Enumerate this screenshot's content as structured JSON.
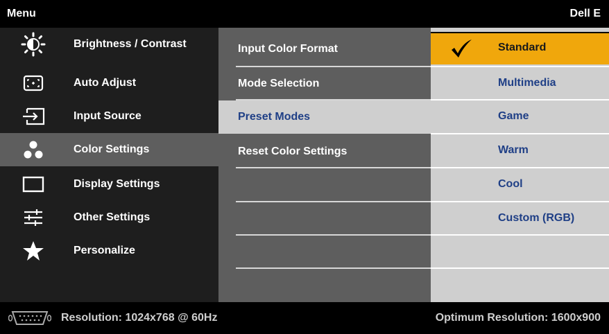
{
  "header": {
    "title": "Menu",
    "brand": "Dell E"
  },
  "nav": {
    "items": [
      {
        "label": "Brightness / Contrast",
        "icon": "brightness-icon"
      },
      {
        "label": "Auto Adjust",
        "icon": "auto-adjust-icon"
      },
      {
        "label": "Input Source",
        "icon": "input-source-icon"
      },
      {
        "label": "Color Settings",
        "icon": "color-settings-icon",
        "active": true
      },
      {
        "label": "Display Settings",
        "icon": "display-settings-icon"
      },
      {
        "label": "Other Settings",
        "icon": "other-settings-icon"
      },
      {
        "label": "Personalize",
        "icon": "star-icon"
      }
    ]
  },
  "color_settings": {
    "items": [
      {
        "label": "Input Color Format"
      },
      {
        "label": "Mode Selection"
      },
      {
        "label": "Preset Modes",
        "highlighted": true
      },
      {
        "label": "Reset Color Settings"
      }
    ]
  },
  "preset_modes": {
    "selected": "Standard",
    "options": [
      {
        "label": "Standard"
      },
      {
        "label": "Multimedia"
      },
      {
        "label": "Game"
      },
      {
        "label": "Warm"
      },
      {
        "label": "Cool"
      },
      {
        "label": "Custom (RGB)"
      }
    ]
  },
  "status": {
    "resolution": "Resolution: 1024x768 @ 60Hz",
    "optimum": "Optimum Resolution: 1600x900",
    "connector_icon": "vga-connector-icon"
  },
  "colors": {
    "accent": "#f0a70c",
    "panel_dark": "#1e1e1e",
    "panel_mid": "#5e5e5e",
    "panel_light": "#cfcfcf",
    "option_text": "#1f3f86"
  }
}
